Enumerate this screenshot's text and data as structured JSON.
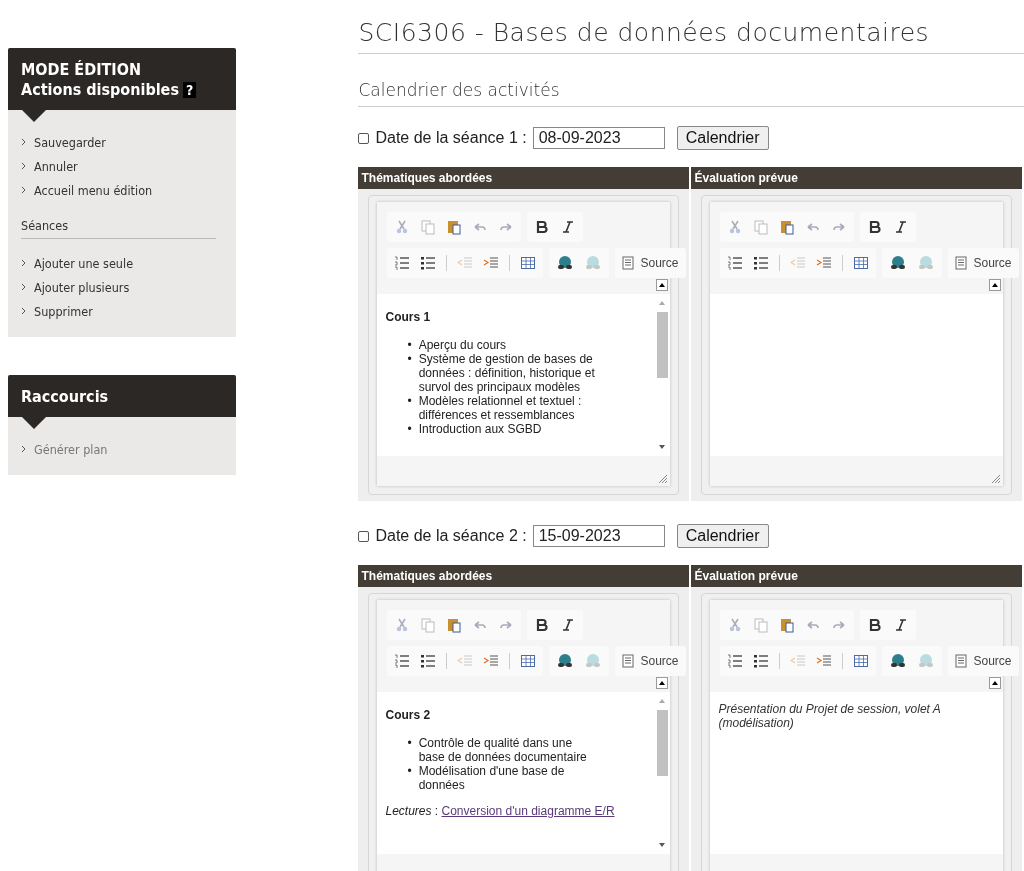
{
  "sidebar": {
    "edit_panel": {
      "title": "MODE ÉDITION",
      "subtitle": "Actions disponibles",
      "help": "?",
      "items": [
        {
          "label": "Sauvegarder",
          "disabled": false
        },
        {
          "label": "Annuler",
          "disabled": false
        },
        {
          "label": "Accueil menu édition",
          "disabled": false
        }
      ],
      "section": {
        "title": "Séances",
        "items": [
          {
            "label": "Ajouter une seule",
            "disabled": false
          },
          {
            "label": "Ajouter plusieurs",
            "disabled": false
          },
          {
            "label": "Supprimer",
            "disabled": false
          }
        ]
      }
    },
    "shortcuts_panel": {
      "title": "Raccourcis",
      "items": [
        {
          "label": "Générer plan",
          "disabled": true
        }
      ]
    }
  },
  "main": {
    "title": "SCI6306 - Bases de données documentaires",
    "section_title": "Calendrier des activités",
    "seances": [
      {
        "checked": false,
        "label": "Date de la séance 1 :",
        "date": "08-09-2023",
        "button": "Calendrier",
        "columns": [
          {
            "header": "Thématiques abordées",
            "source_label": "Source",
            "content": [
              {
                "kind": "heading",
                "text": "Cours 1"
              },
              {
                "kind": "list",
                "marker": "•",
                "items": [
                  "Aperçu du cours",
                  "Système de gestion de bases de données : définition, historique et survol des principaux modèles",
                  "Modèles relationnel et textuel : différences et ressemblances",
                  "Introduction aux SGBD"
                ]
              }
            ]
          },
          {
            "header": "Évaluation prévue",
            "source_label": "Source"
          }
        ]
      },
      {
        "checked": false,
        "label": "Date de la séance 2 :",
        "date": "15-09-2023",
        "button": "Calendrier",
        "columns": [
          {
            "header": "Thématiques abordées",
            "source_label": "Source",
            "content": [
              {
                "kind": "heading",
                "text": "Cours 2"
              },
              {
                "kind": "list",
                "marker": "•",
                "items": [
                  "Contrôle de qualité dans une base de données documentaire",
                  "Modélisation d'une base de données"
                ]
              },
              {
                "kind": "reference",
                "label": "Lectures",
                "separator": " : ",
                "link": "Conversion d'un diagramme E/R"
              }
            ]
          },
          {
            "header": "Évaluation prévue",
            "source_label": "Source",
            "content": [
              {
                "kind": "note",
                "text": "Présentation du Projet de session, volet A (modélisation)"
              }
            ]
          }
        ]
      }
    ]
  }
}
